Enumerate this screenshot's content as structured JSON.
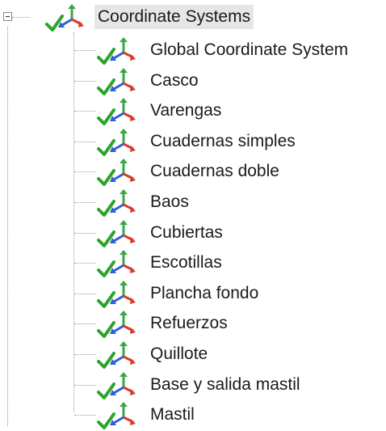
{
  "tree": {
    "root": {
      "label": "Coordinate Systems",
      "expanded": true,
      "checked": true,
      "icon": "coordinate-system-icon"
    },
    "children": [
      {
        "label": "Global Coordinate System",
        "checked": true,
        "icon": "coordinate-system-icon"
      },
      {
        "label": "Casco",
        "checked": true,
        "icon": "coordinate-system-icon"
      },
      {
        "label": "Varengas",
        "checked": true,
        "icon": "coordinate-system-icon"
      },
      {
        "label": "Cuadernas simples",
        "checked": true,
        "icon": "coordinate-system-icon"
      },
      {
        "label": "Cuadernas doble",
        "checked": true,
        "icon": "coordinate-system-icon"
      },
      {
        "label": "Baos",
        "checked": true,
        "icon": "coordinate-system-icon"
      },
      {
        "label": "Cubiertas",
        "checked": true,
        "icon": "coordinate-system-icon"
      },
      {
        "label": "Escotillas",
        "checked": true,
        "icon": "coordinate-system-icon"
      },
      {
        "label": "Plancha fondo",
        "checked": true,
        "icon": "coordinate-system-icon"
      },
      {
        "label": "Refuerzos",
        "checked": true,
        "icon": "coordinate-system-icon"
      },
      {
        "label": "Quillote",
        "checked": true,
        "icon": "coordinate-system-icon"
      },
      {
        "label": "Base y salida mastil",
        "checked": true,
        "icon": "coordinate-system-icon"
      },
      {
        "label": "Mastil",
        "checked": true,
        "icon": "coordinate-system-icon"
      }
    ]
  },
  "colors": {
    "check_green": "#2aa52a",
    "axis_red": "#d93a2b",
    "axis_blue": "#2f5fd0",
    "axis_green": "#3aa64a",
    "tree_line": "#9a9a9a",
    "selection_bg": "#e6e6e6"
  }
}
